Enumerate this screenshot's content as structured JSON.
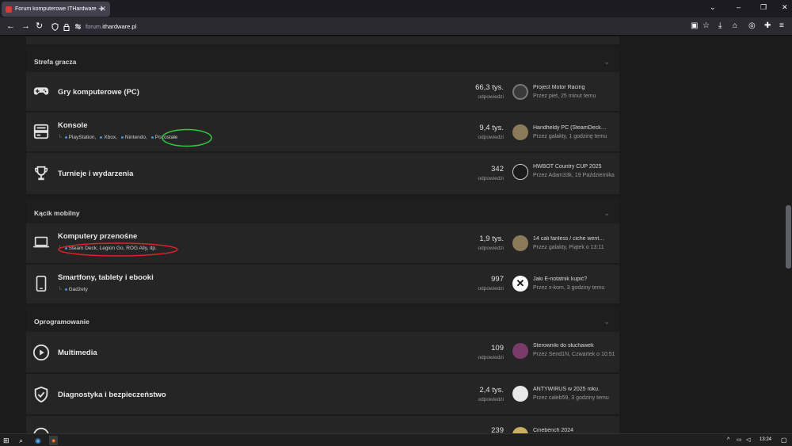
{
  "browser": {
    "tab_title": "Forum komputerowe ITHardware",
    "tab_close": "✕",
    "new_tab": "+",
    "url_prefix": "forum.",
    "url_domain": "ithardware.pl"
  },
  "sections": [
    {
      "title": "Strefa gracza",
      "forums": [
        {
          "icon": "gamepad-icon",
          "title": "Gry komputerowe (PC)",
          "subforums": [],
          "count": "66,3 tys.",
          "count_label": "odpowiedzi",
          "last_title": "Project Motor Racing",
          "last_meta": "Przez piet, 25 minut temu"
        },
        {
          "icon": "console-icon",
          "title": "Konsole",
          "subforums": [
            "PlayStation,",
            "Xbox,",
            "Nintendo,",
            "Pozostałe"
          ],
          "count": "9,4 tys.",
          "count_label": "odpowiedzi",
          "last_title": "Handheldy PC (SteamDeck…",
          "last_meta": "Przez galakty, 1 godzinę temu"
        },
        {
          "icon": "trophy-icon",
          "title": "Turnieje i wydarzenia",
          "subforums": [],
          "count": "342",
          "count_label": "odpowiedzi",
          "last_title": "HWBOT Country CUP 2025",
          "last_meta": "Przez Adam33k, 19 Października"
        }
      ]
    },
    {
      "title": "Kącik mobilny",
      "forums": [
        {
          "icon": "laptop-icon",
          "title": "Komputery przenośne",
          "subforums": [
            "Steam Deck, Legion Go, ROG Ally, itp."
          ],
          "count": "1,9 tys.",
          "count_label": "odpowiedzi",
          "last_title": "14 cali fanless / ciche went…",
          "last_meta": "Przez galakty, Piątek o 13:11"
        },
        {
          "icon": "smartphone-icon",
          "title": "Smartfony, tablety i ebooki",
          "subforums": [
            "Gadżety"
          ],
          "count": "997",
          "count_label": "odpowiedzi",
          "last_title": "Jaki E-notatnik kupić?",
          "last_meta": "Przez x-kom, 3 godziny temu"
        }
      ]
    },
    {
      "title": "Oprogramowanie",
      "forums": [
        {
          "icon": "play-icon",
          "title": "Multimedia",
          "subforums": [],
          "count": "109",
          "count_label": "odpowiedzi",
          "last_title": "Sterowniki do słuchawek",
          "last_meta": "Przez Send1N, Czwartek o 10:51"
        },
        {
          "icon": "shield-check-icon",
          "title": "Diagnostyka i bezpieczeństwo",
          "subforums": [],
          "count": "2,4 tys.",
          "count_label": "odpowiedzi",
          "last_title": "ANTYWIRUS w 2025 roku.",
          "last_meta": "Przez caleb59, 3 godziny temu"
        },
        {
          "icon": "gauge-icon",
          "title": "",
          "subforums": [],
          "count": "239",
          "count_label": "",
          "last_title": "Cinebench 2024",
          "last_meta": ""
        }
      ]
    }
  ],
  "taskbar": {
    "time": "13:24"
  },
  "colors": {
    "page_bg": "#1b1b1b",
    "row_bg": "#252525",
    "subforum_dot": "#4a8fd8",
    "annotation_green": "#2ecc40",
    "annotation_red": "#e0202a"
  }
}
